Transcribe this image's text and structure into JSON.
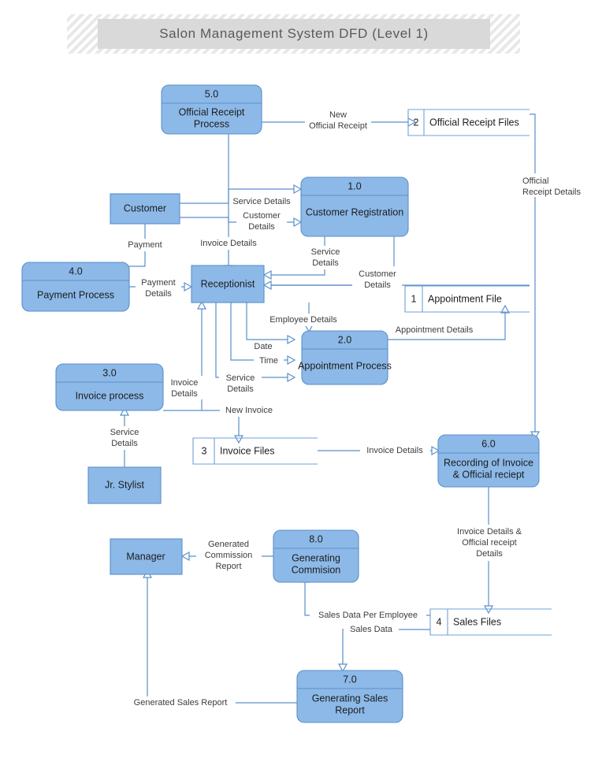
{
  "title": "Salon Management System DFD (Level 1)",
  "diagram": {
    "type": "data-flow-diagram",
    "level": "1",
    "processes": [
      {
        "id": "p5",
        "number": "5.0",
        "name": "Official Receipt Process",
        "lines": [
          "Official Receipt",
          "Process"
        ]
      },
      {
        "id": "p1",
        "number": "1.0",
        "name": "Customer Registration",
        "lines": [
          "Customer Registration"
        ]
      },
      {
        "id": "p4",
        "number": "4.0",
        "name": "Payment Process",
        "lines": [
          "Payment Process"
        ]
      },
      {
        "id": "p2",
        "number": "2.0",
        "name": "Appointment Process",
        "lines": [
          "Appointment Process"
        ]
      },
      {
        "id": "p3",
        "number": "3.0",
        "name": "Invoice process",
        "lines": [
          "Invoice process"
        ]
      },
      {
        "id": "p6",
        "number": "6.0",
        "name": "Recording of Invoice & Official reciept",
        "lines": [
          "Recording of Invoice",
          "& Official reciept"
        ]
      },
      {
        "id": "p8",
        "number": "8.0",
        "name": "Generating Commision",
        "lines": [
          "Generating",
          "Commision"
        ]
      },
      {
        "id": "p7",
        "number": "7.0",
        "name": "Generating Sales Report",
        "lines": [
          "Generating Sales",
          "Report"
        ]
      }
    ],
    "entities": [
      {
        "id": "e_customer",
        "name": "Customer"
      },
      {
        "id": "e_receptionist",
        "name": "Receptionist"
      },
      {
        "id": "e_jrstylist",
        "name": "Jr. Stylist"
      },
      {
        "id": "e_manager",
        "name": "Manager"
      }
    ],
    "datastores": [
      {
        "id": "d1",
        "number": "1",
        "name": "Appointment File"
      },
      {
        "id": "d2",
        "number": "2",
        "name": "Official Receipt Files"
      },
      {
        "id": "d3",
        "number": "3",
        "name": "Invoice Files"
      },
      {
        "id": "d4",
        "number": "4",
        "name": "Sales Files"
      }
    ],
    "flows": [
      {
        "id": "f1",
        "label": "New Official Receipt",
        "lines": [
          "New",
          "Official Receipt"
        ],
        "from": "p5",
        "to": "d2"
      },
      {
        "id": "f2",
        "label": "Official Receipt Details",
        "lines": [
          "Official",
          "Receipt Details"
        ],
        "from": "d2",
        "to": "p6"
      },
      {
        "id": "f3",
        "label": "Service Details",
        "lines": [
          "Service Details"
        ],
        "from": "e_customer",
        "to": "p1"
      },
      {
        "id": "f4",
        "label": "Customer Details",
        "lines": [
          "Customer",
          "Details"
        ],
        "from": "e_customer",
        "to": "p1"
      },
      {
        "id": "f5",
        "label": "Payment",
        "lines": [
          "Payment"
        ],
        "from": "e_customer",
        "to": "p4"
      },
      {
        "id": "f6",
        "label": "Invoice Details",
        "lines": [
          "Invoice Details"
        ],
        "from": "p5",
        "to": "e_receptionist"
      },
      {
        "id": "f7",
        "label": "Service Details",
        "lines": [
          "Service",
          "Details"
        ],
        "from": "p1",
        "to": "e_receptionist"
      },
      {
        "id": "f8",
        "label": "Customer Details",
        "lines": [
          "Customer",
          "Details"
        ],
        "from": "p1",
        "to": "e_receptionist"
      },
      {
        "id": "f9",
        "label": "Payment Details",
        "lines": [
          "Payment",
          "Details"
        ],
        "from": "p4",
        "to": "e_receptionist"
      },
      {
        "id": "f10",
        "label": "Employee Details",
        "lines": [
          "Employee Details"
        ],
        "from": "e_receptionist",
        "to": "p2"
      },
      {
        "id": "f11",
        "label": "Date",
        "lines": [
          "Date"
        ],
        "from": "e_receptionist",
        "to": "p2"
      },
      {
        "id": "f12",
        "label": "Time",
        "lines": [
          "Time"
        ],
        "from": "e_receptionist",
        "to": "p2"
      },
      {
        "id": "f13",
        "label": "Service Details",
        "lines": [
          "Service",
          "Details"
        ],
        "from": "e_receptionist",
        "to": "p2"
      },
      {
        "id": "f14",
        "label": "Appointment Details",
        "lines": [
          "Appointment Details"
        ],
        "from": "p2",
        "to": "d1"
      },
      {
        "id": "f15",
        "label": "Customer Details",
        "lines": [
          "Customer",
          "Details"
        ],
        "from": "d1",
        "to": "e_receptionist"
      },
      {
        "id": "f16",
        "label": "Invoice Details",
        "lines": [
          "Invoice",
          "Details"
        ],
        "from": "p3",
        "to": "e_receptionist"
      },
      {
        "id": "f17",
        "label": "Service Details",
        "lines": [
          "Service",
          "Details"
        ],
        "from": "e_jrstylist",
        "to": "p3"
      },
      {
        "id": "f18",
        "label": "New Invoice",
        "lines": [
          "New Invoice"
        ],
        "from": "p3",
        "to": "d3"
      },
      {
        "id": "f19",
        "label": "Invoice Details",
        "lines": [
          "Invoice Details"
        ],
        "from": "d3",
        "to": "p6"
      },
      {
        "id": "f20",
        "label": "Invoice Details & Official receipt Details",
        "lines": [
          "Invoice Details &",
          "Official receipt",
          "Details"
        ],
        "from": "p6",
        "to": "d4"
      },
      {
        "id": "f21",
        "label": "Sales Data Per Employee",
        "lines": [
          "Sales Data Per Employee"
        ],
        "from": "d4",
        "to": "p8"
      },
      {
        "id": "f22",
        "label": "Sales Data",
        "lines": [
          "Sales Data"
        ],
        "from": "d4",
        "to": "p7"
      },
      {
        "id": "f23",
        "label": "Generated Commission Report",
        "lines": [
          "Generated",
          "Commission",
          "Report"
        ],
        "from": "p8",
        "to": "e_manager"
      },
      {
        "id": "f24",
        "label": "Generated Sales Report",
        "lines": [
          "Generated Sales Report"
        ],
        "from": "p7",
        "to": "e_manager"
      }
    ]
  },
  "colors": {
    "node_fill": "#8cb9e8",
    "node_stroke": "#5b8fc9",
    "flow_stroke": "#5b8fc9",
    "title_band": "#d9d9d9",
    "title_text": "#595959"
  }
}
